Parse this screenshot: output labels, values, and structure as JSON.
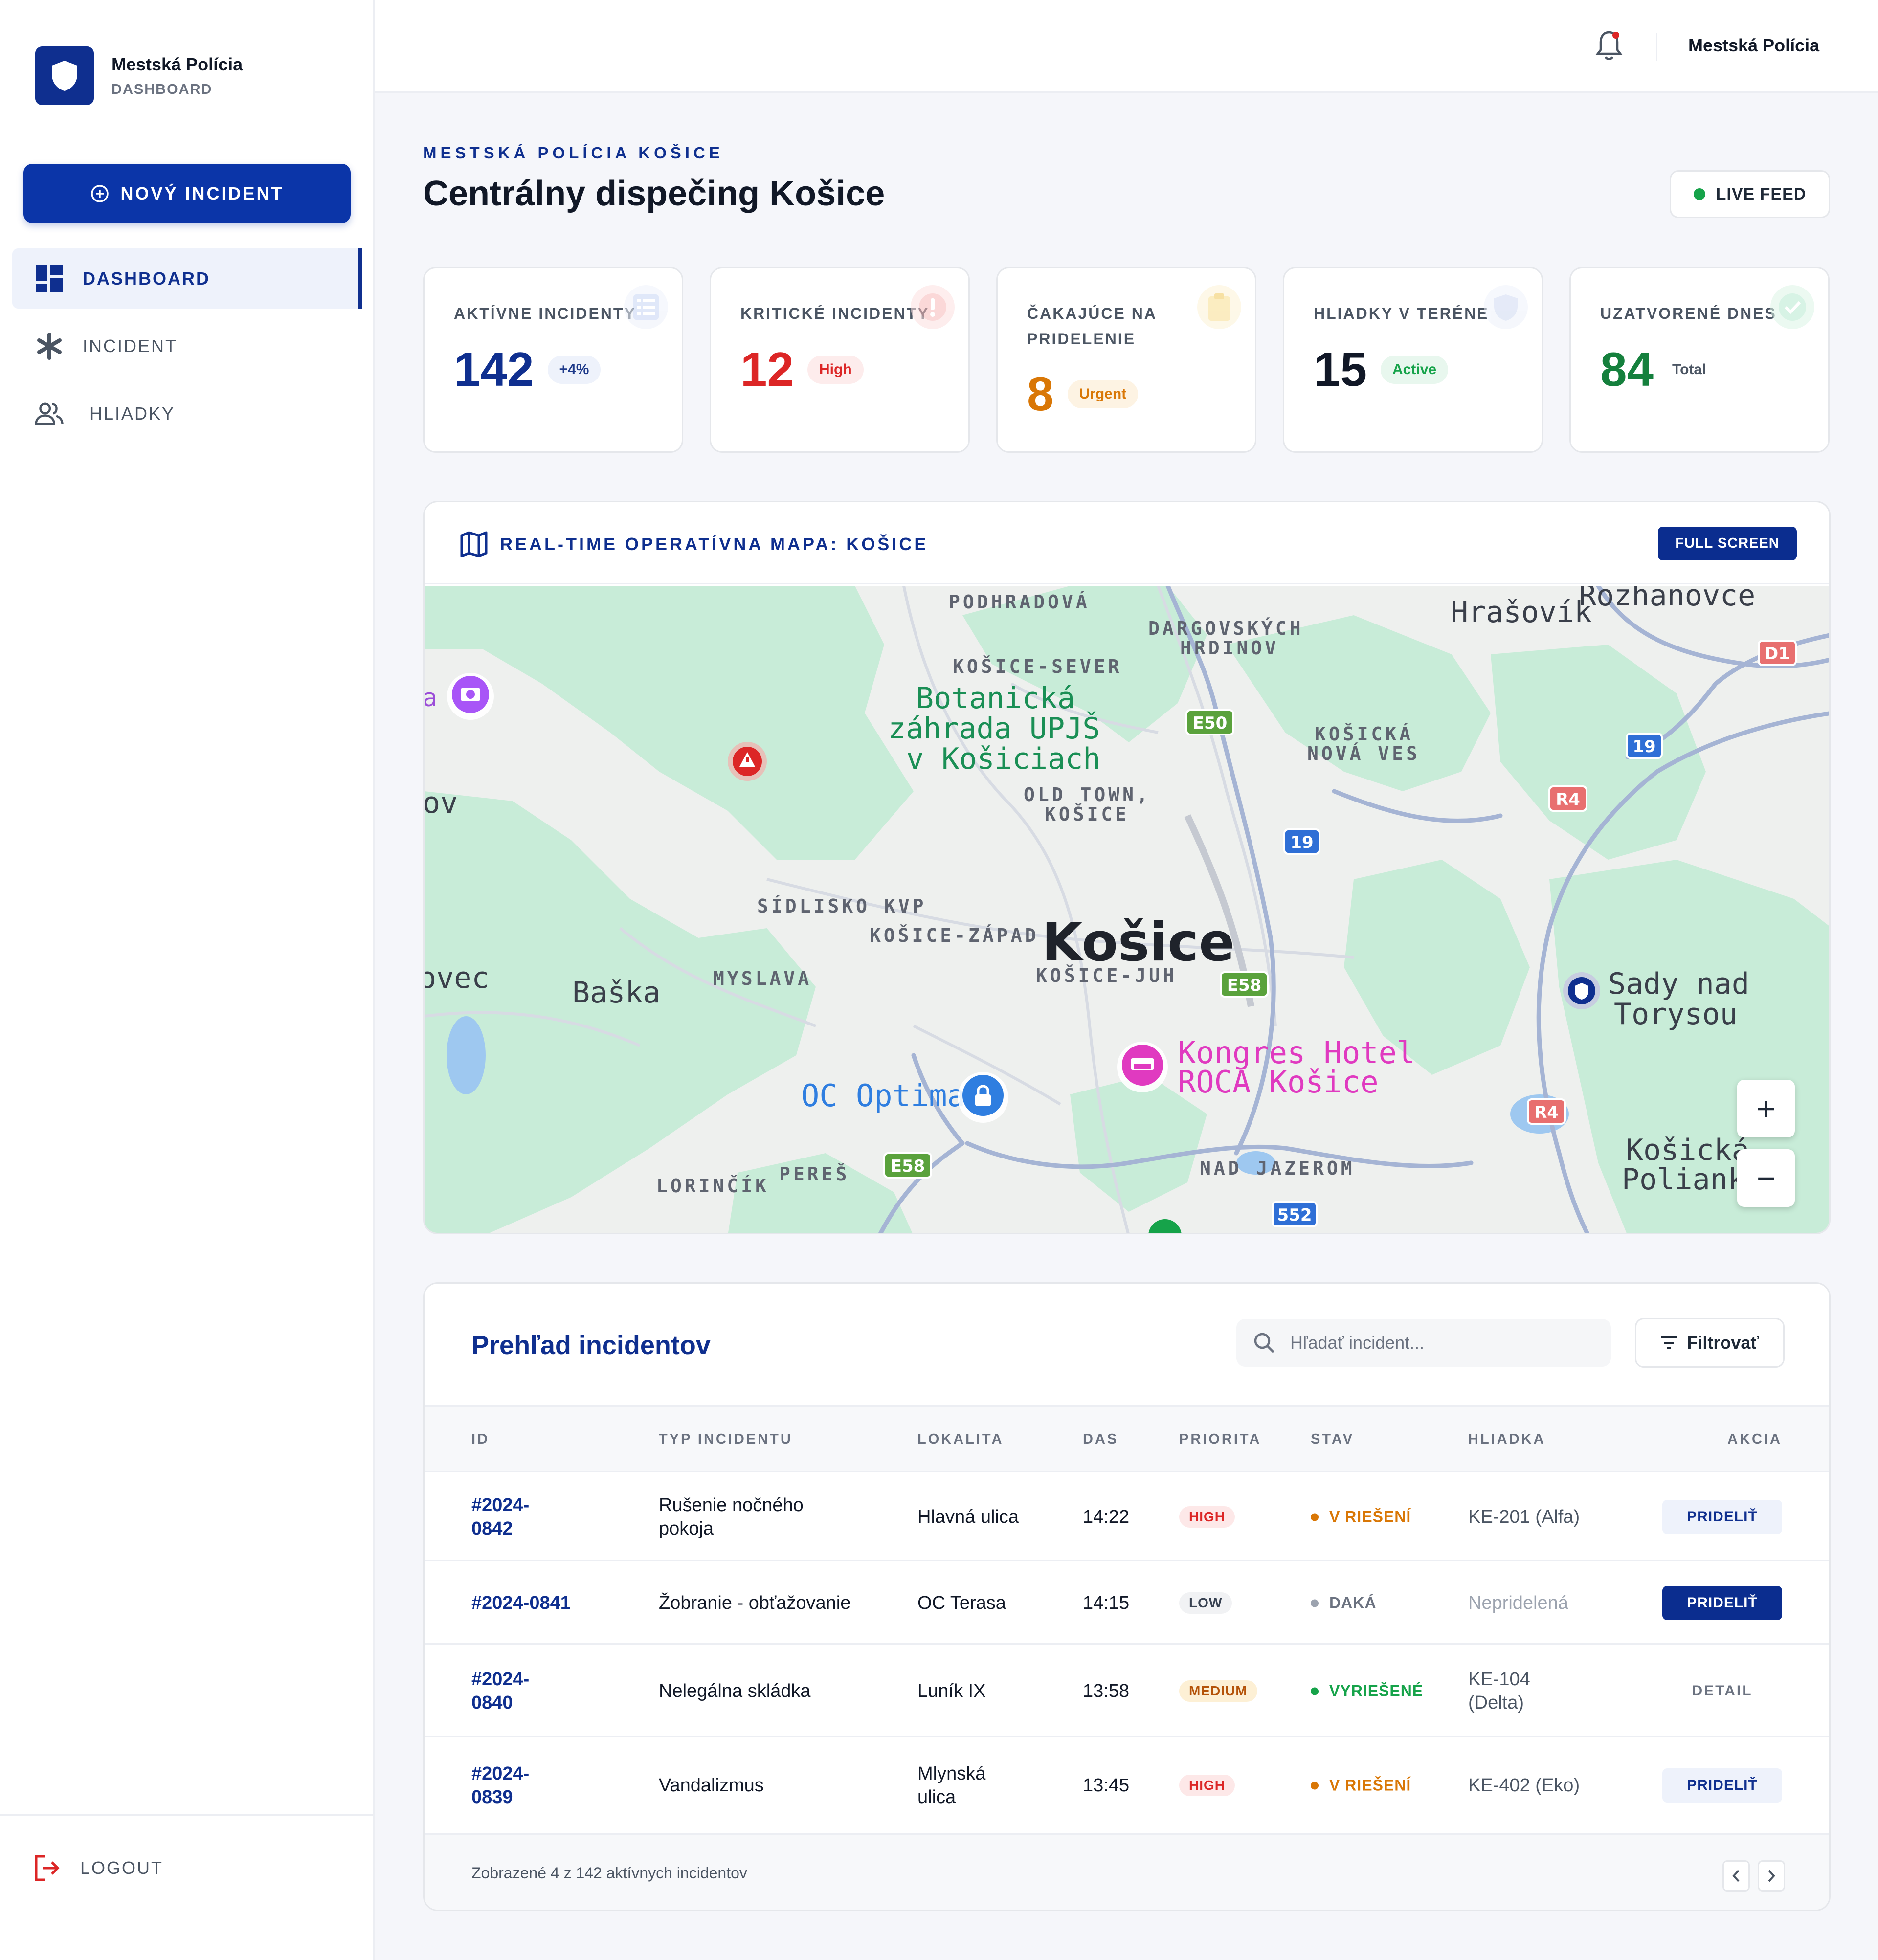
{
  "sidebar": {
    "brand_title": "Mestská Polícia",
    "brand_subtitle": "DASHBOARD",
    "new_incident_label": "NOVÝ INCIDENT",
    "items": [
      {
        "label": "DASHBOARD",
        "icon": "dashboard-grid-icon",
        "active": true
      },
      {
        "label": "INCIDENT",
        "icon": "asterisk-icon",
        "active": false
      },
      {
        "label": "HLIADKY",
        "icon": "users-icon",
        "active": false
      }
    ],
    "logout_label": "LOGOUT"
  },
  "topbar": {
    "user_name": "Mestská Polícia",
    "notification_icon": "bell-icon"
  },
  "header": {
    "eyebrow": "MESTSKÁ POLÍCIA KOŠICE",
    "title": "Centrálny dispečing Košice",
    "live_feed_label": "LIVE FEED"
  },
  "stats": [
    {
      "label": "AKTÍVNE INCIDENTY",
      "value": "142",
      "badge": "+4%",
      "color": "#0f2f8f",
      "badge_bg": "#eef2fb",
      "badge_color": "#1e3a8a",
      "icon": "list-icon"
    },
    {
      "label": "KRITICKÉ INCIDENTY",
      "value": "12",
      "badge": "High",
      "color": "#dc2626",
      "badge_bg": "#fdecec",
      "badge_color": "#dc2626",
      "icon": "alert-icon"
    },
    {
      "label": "ČAKAJÚCE NA PRIDELENIE",
      "value": "8",
      "badge": "Urgent",
      "color": "#d97706",
      "badge_bg": "#fdf3e3",
      "badge_color": "#d97706",
      "icon": "clipboard-icon"
    },
    {
      "label": "HLIADKY V TERÉNE",
      "value": "15",
      "badge": "Active",
      "color": "#111827",
      "badge_bg": "#e8f7ee",
      "badge_color": "#16a34a",
      "icon": "shield-icon"
    },
    {
      "label": "UZATVORENÉ DNES",
      "value": "84",
      "badge": "Total",
      "color": "#15803d",
      "badge_bg": "transparent",
      "badge_color": "#4b5563",
      "icon": "check-icon"
    }
  ],
  "map": {
    "title": "REAL-TIME OPERATÍVNA MAPA: KOŠICE",
    "full_screen_label": "FULL SCREEN",
    "zoom_in": "+",
    "zoom_out": "−",
    "labels": {
      "podhradova": "PODHRADOVÁ",
      "dargovskych1": "DARGOVSKÝCH",
      "dargovskych2": "HRDINOV",
      "hrasovik": "Hrašovík",
      "rozhanovce": "Rozhanovce",
      "kosice_sever": "KOŠICE-SEVER",
      "botanicka1": "Botanická",
      "botanicka2": "záhrada UPJŠ",
      "botanicka3": "v Košiciach",
      "nova_ves1": "KOŠICKÁ",
      "nova_ves2": "NOVÁ VES",
      "old_town1": "OLD TOWN,",
      "old_town2": "KOŠICE",
      "kosice": "Košice",
      "sidlisko_kvp": "SÍDLISKO KVP",
      "kosice_zapad": "KOŠICE-ZÁPAD",
      "myslava": "MYSLAVA",
      "kosice_juh": "KOŠICE-JUH",
      "baska": "Baška",
      "ovec": "ovec",
      "ov": "ov",
      "a": "a",
      "sady1": "Sady nad",
      "sady2": "Torysou",
      "kongres1": "Kongres Hotel",
      "kongres2": "ROCA Košice",
      "oc_optima": "OC Optima",
      "polianka1": "Košická",
      "polianka2": "Polianka",
      "lorincik": "LORINČÍK",
      "peres": "PEREŠ",
      "nad_jazerom": "NAD JAZEROM",
      "r_d1": "D1",
      "r_e50": "E50",
      "r_19a": "19",
      "r_19b": "19",
      "r_r4a": "R4",
      "r_r4b": "R4",
      "r_e58a": "E58",
      "r_e58b": "E58",
      "r_552": "552"
    }
  },
  "table": {
    "title": "Prehľad incidentov",
    "search_placeholder": "Hľadať incident...",
    "filter_label": "Filtrovať",
    "columns": [
      "ID",
      "TYP INCIDENTU",
      "LOKALITA",
      "DAS",
      "PRIORITA",
      "STAV",
      "HLIADKA",
      "AKCIA"
    ],
    "rows": [
      {
        "id": "#2024-\n0842",
        "type": "Rušenie nočného\npokoja",
        "location": "Hlavná ulica",
        "time": "14:22",
        "priority": "HIGH",
        "status": "V RIEŠENÍ",
        "patrol": "KE-201 (Alfa)",
        "action": "PRIDELIŤ"
      },
      {
        "id": "#2024-0841",
        "type": "Žobranie - obťažovanie",
        "location": "OC Terasa",
        "time": "14:15",
        "priority": "LOW",
        "status": "DAKÁ",
        "patrol": "Nepridelená",
        "action": "PRIDELIŤ"
      },
      {
        "id": "#2024-\n0840",
        "type": "Nelegálna skládka",
        "location": "Luník IX",
        "time": "13:58",
        "priority": "MEDIUM",
        "status": "VYRIEŠENÉ",
        "patrol": "KE-104\n(Delta)",
        "action": "DETAIL"
      },
      {
        "id": "#2024-\n0839",
        "type": "Vandalizmus",
        "location": "Mlynská\nulica",
        "time": "13:45",
        "priority": "HIGH",
        "status": "V RIEŠENÍ",
        "patrol": "KE-402 (Eko)",
        "action": "PRIDELIŤ"
      }
    ],
    "footer_text": "Zobrazené 4 z 142 aktívnych incidentov"
  },
  "colors": {
    "primary": "#0f2f8f",
    "accent_button": "#0b35a8",
    "high": "#dc2626",
    "medium": "#d97706",
    "low": "#6b7280",
    "resolved": "#16a34a"
  }
}
